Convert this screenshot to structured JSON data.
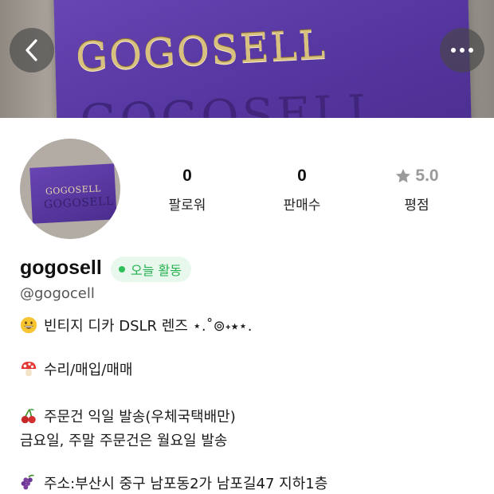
{
  "cover": {
    "brand_top": "GOGOSELL",
    "brand_bottom": "GOGOSELL"
  },
  "avatar": {
    "brand_top": "GOGOSELL",
    "brand_bottom": "GOGOSELL"
  },
  "stats": {
    "followers": {
      "value": "0",
      "label": "팔로워"
    },
    "sales": {
      "value": "0",
      "label": "판매수"
    },
    "rating": {
      "value": "5.0",
      "label": "평점"
    }
  },
  "profile": {
    "username": "gogosell",
    "badge": "오늘 활동",
    "handle": "@gogocell"
  },
  "bio": {
    "line1": "빈티지 디카 DSLR 렌즈 ⋆.˚⊚˖⭑⋆.",
    "line2": "수리/매입/매매",
    "line3": "주문건 익일 발송(우체국택배만)",
    "line4": "금요일, 주말 주문건은 월요일 발송",
    "line5": "주소:부산시 중구 남포동2가 남포길47 지하1층"
  },
  "icons": {
    "back": "chevron-left-icon",
    "more": "more-horizontal-icon",
    "star": "star-icon",
    "status": "online-dot-icon"
  },
  "colors": {
    "accent_green": "#2fbf5a",
    "badge_bg": "#e8f8ec",
    "rating_gray": "#9a9a9a",
    "brand_purple": "#5838a2"
  }
}
